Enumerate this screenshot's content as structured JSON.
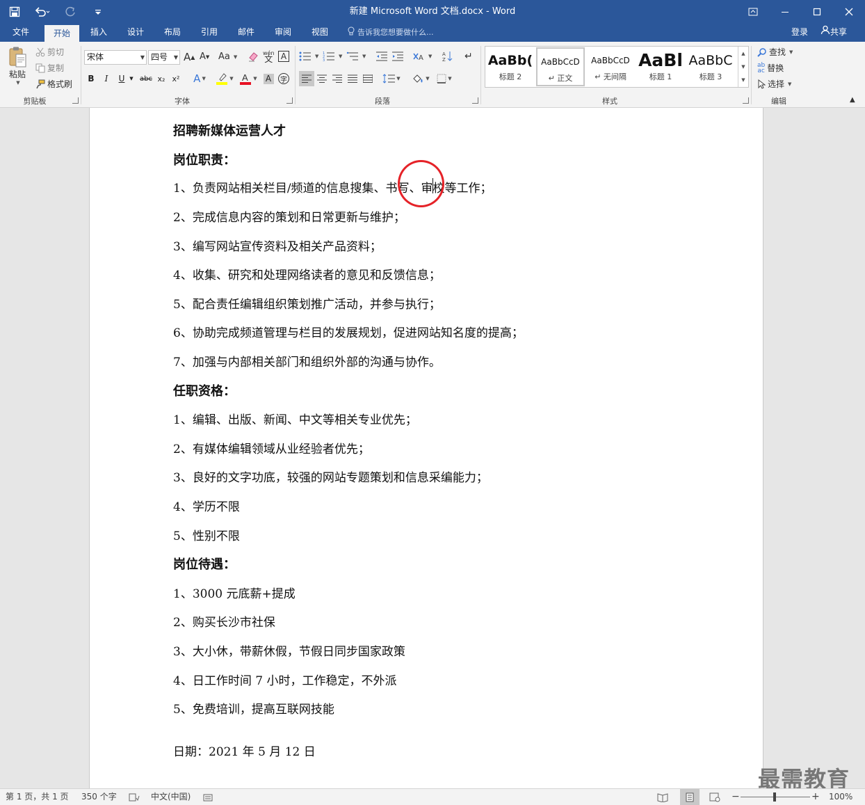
{
  "titlebar": {
    "title": "新建 Microsoft Word 文档.docx - Word",
    "qat": [
      "save-icon",
      "undo-icon",
      "redo-icon",
      "customize-icon"
    ],
    "window_controls": [
      "ribbon-display-icon",
      "minimize-icon",
      "maximize-icon",
      "close-icon"
    ]
  },
  "tabs": {
    "items": [
      "文件",
      "开始",
      "插入",
      "设计",
      "布局",
      "引用",
      "邮件",
      "审阅",
      "视图"
    ],
    "active": "开始",
    "tell_me": "告诉我您想要做什么...",
    "login": "登录",
    "share": "共享"
  },
  "ribbon": {
    "clipboard": {
      "label": "剪贴板",
      "paste": "粘贴",
      "cut": "剪切",
      "copy": "复制",
      "format_painter": "格式刷"
    },
    "font": {
      "label": "字体",
      "font_name": "宋体",
      "font_size": "四号",
      "case_label": "Aa",
      "clear_format_label": "wén",
      "bold": "B",
      "italic": "I",
      "underline": "U",
      "strike": "abc",
      "sub": "x₂",
      "sup": "x²",
      "highlight_color": "#ffff00",
      "font_color": "#e81123"
    },
    "paragraph": {
      "label": "段落"
    },
    "styles": {
      "label": "样式",
      "items": [
        {
          "preview": "AaBb(",
          "name": "标题 2"
        },
        {
          "preview": "AaBbCcD",
          "name": "↵ 正文"
        },
        {
          "preview": "AaBbCcD",
          "name": "↵ 无间隔"
        },
        {
          "preview": "AaBl",
          "name": "标题 1"
        },
        {
          "preview": "AaBbC",
          "name": "标题 3"
        }
      ]
    },
    "editing": {
      "label": "编辑",
      "find": "查找",
      "replace": "替换",
      "select": "选择"
    }
  },
  "document": {
    "title": "招聘新媒体运营人才",
    "sections": [
      {
        "heading": "岗位职责：",
        "items": [
          "1、负责网站相关栏目/频道的信息搜集、书写、审校等工作；",
          "2、完成信息内容的策划和日常更新与维护；",
          "3、编写网站宣传资料及相关产品资料；",
          "4、收集、研究和处理网络读者的意见和反馈信息；",
          "5、配合责任编辑组织策划推广活动，并参与执行；",
          "6、协助完成频道管理与栏目的发展规划，促进网站知名度的提高；",
          "7、加强与内部相关部门和组织外部的沟通与协作。"
        ]
      },
      {
        "heading": "任职资格：",
        "items": [
          "1、编辑、出版、新闻、中文等相关专业优先；",
          "2、有媒体编辑领域从业经验者优先；",
          "3、良好的文字功底，较强的网站专题策划和信息采编能力；",
          "4、学历不限",
          "5、性别不限"
        ]
      },
      {
        "heading": "岗位待遇：",
        "items": [
          "1、3000 元底薪+提成",
          "2、购买长沙市社保",
          "3、大小休，带薪休假，节假日同步国家政策",
          "4、日工作时间 7 小时，工作稳定，不外派",
          "5、免费培训，提高互联网技能"
        ]
      }
    ],
    "date": "日期：2021 年 5 月 12 日",
    "annotation_color": "#e52228"
  },
  "statusbar": {
    "page": "第 1 页，共 1 页",
    "words": "350 个字",
    "language": "中文(中国)",
    "zoom": "100%"
  },
  "watermark": "最需教育"
}
